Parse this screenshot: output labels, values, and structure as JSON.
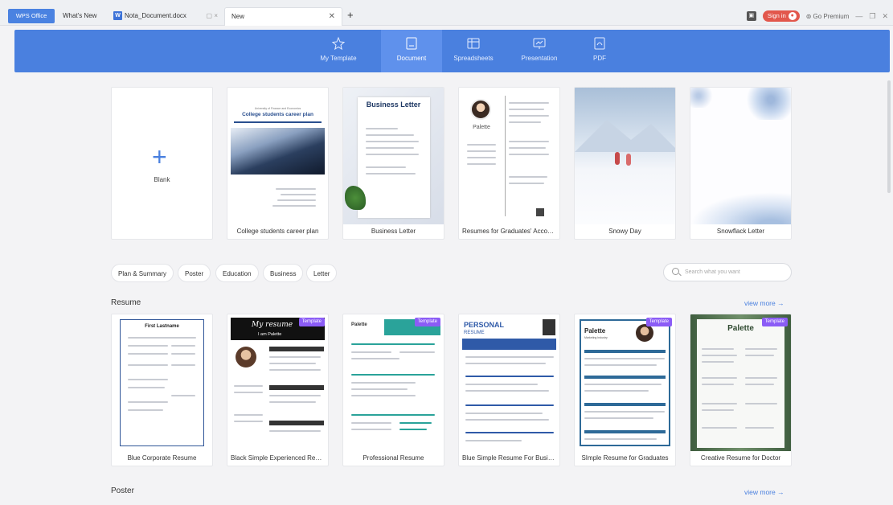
{
  "tabs": {
    "wps": "WPS Office",
    "whats_new": "What's New",
    "doc": "Nota_Document.docx",
    "doc_icon": "W",
    "new": "New"
  },
  "topbar": {
    "sign_in": "Sign in",
    "premium": "Go Premium"
  },
  "categories": [
    {
      "label": "My Template",
      "icon": "star-icon"
    },
    {
      "label": "Document",
      "icon": "document-icon"
    },
    {
      "label": "Spreadsheets",
      "icon": "spreadsheet-icon"
    },
    {
      "label": "Presentation",
      "icon": "presentation-icon"
    },
    {
      "label": "PDF",
      "icon": "pdf-icon"
    }
  ],
  "featured": {
    "blank": "Blank",
    "cards": [
      "College students career plan",
      "Business Letter",
      "Resumes for Graduates' Accou...",
      "Snowy Day",
      "Snowflack Letter"
    ],
    "thumb_text": {
      "college_header": "University of Finance and Economics",
      "college_title": "College students career plan",
      "business_title": "Business Letter",
      "palette": "Palette"
    }
  },
  "chips": [
    "Plan & Summary",
    "Poster",
    "Education",
    "Business",
    "Letter"
  ],
  "search_placeholder": "Search what you want",
  "resume": {
    "title": "Resume",
    "view_more": "view more →",
    "badge": "Template",
    "cards": [
      "Blue Corporate Resume",
      "Black Simple Experienced Resu...",
      "Professional Resume",
      "Blue Simple Resume For Busine...",
      "SImple Resume for Graduates",
      "Creative Resume for Doctor"
    ],
    "thumb_text": {
      "first_lastname": "First Lastname",
      "my_resume": "My resume",
      "i_am_palette": "I am Palette",
      "palette": "Palette",
      "personal": "PERSONAL",
      "resume_word": "RESUME",
      "marketing": "Marketing Industry"
    }
  },
  "poster": {
    "title": "Poster",
    "view_more": "view more →"
  },
  "colors": {
    "accent": "#4a80df",
    "badge": "#8b5cf6",
    "sign_in": "#e2574c"
  }
}
